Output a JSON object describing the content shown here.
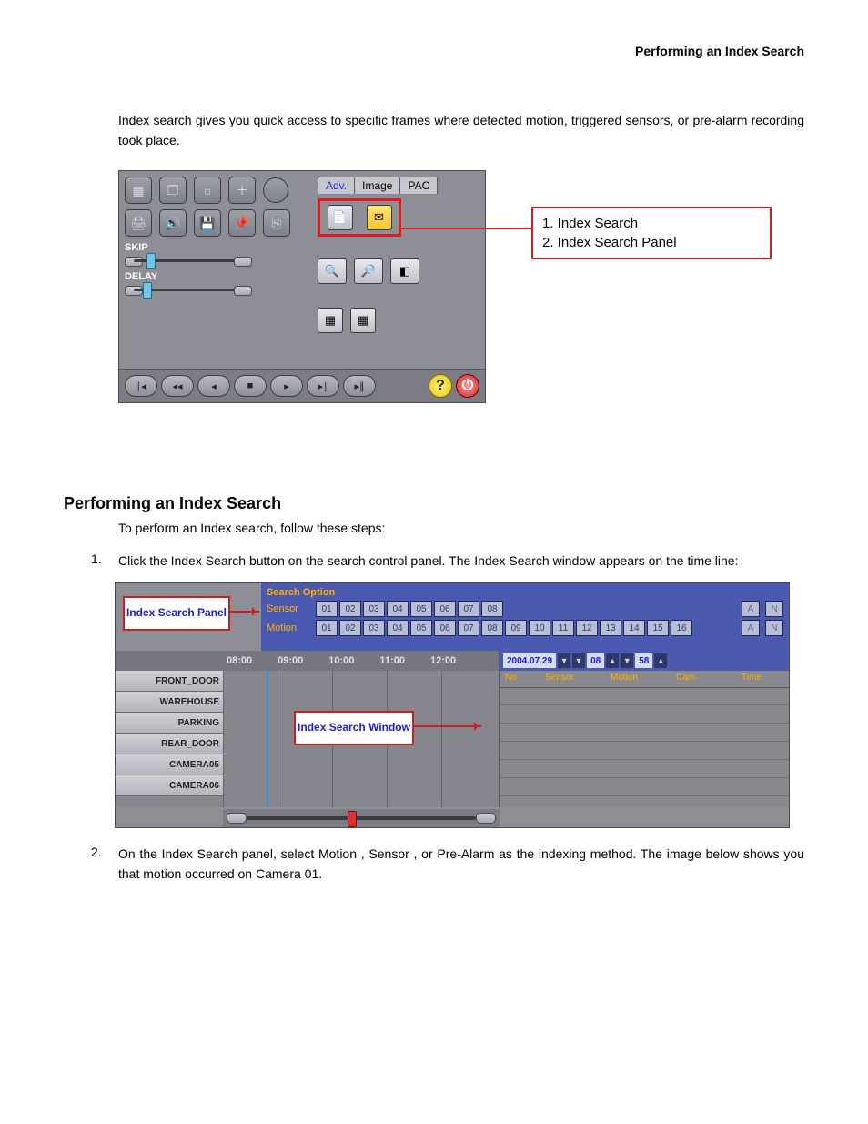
{
  "header": {
    "title": "Performing an Index Search"
  },
  "intro": "Index search gives you quick access to specific frames where detected motion, triggered sensors, or pre-alarm recording took place.",
  "fig1": {
    "tabs": [
      "Adv.",
      "Image",
      "PAC"
    ],
    "skip_label": "SKIP",
    "delay_label": "DELAY",
    "callout_lines": [
      "1. Index Search",
      "2. Index Search Panel"
    ]
  },
  "section_heading": "Performing an Index Search",
  "section_intro": "To perform an Index search, follow these steps:",
  "steps": [
    "Click the Index Search button on the search control panel. The Index Search window appears on the time line:",
    "On the Index Search panel, select Motion , Sensor , or Pre-Alarm as the indexing method. The image below shows you that motion occurred on Camera 01."
  ],
  "fig2": {
    "callouts": {
      "panel": "Index Search Panel",
      "window": "Index Search Window"
    },
    "search_option": {
      "title": "Search Option",
      "sensor_label": "Sensor",
      "motion_label": "Motion",
      "sensor_nums": [
        "01",
        "02",
        "03",
        "04",
        "05",
        "06",
        "07",
        "08"
      ],
      "motion_nums": [
        "01",
        "02",
        "03",
        "04",
        "05",
        "06",
        "07",
        "08",
        "09",
        "10",
        "11",
        "12",
        "13",
        "14",
        "15",
        "16"
      ],
      "an": [
        "A",
        "N"
      ]
    },
    "timeline_hours": [
      "08:00",
      "09:00",
      "10:00",
      "11:00",
      "12:00"
    ],
    "cameras": [
      "FRONT_DOOR",
      "WAREHOUSE",
      "PARKING",
      "REAR_DOOR",
      "CAMERA05",
      "CAMERA06"
    ],
    "index_window": {
      "date": "2004.07.29",
      "hour": "08",
      "minute": "58",
      "columns": [
        "No",
        "Sensor",
        "Motion",
        "Cam",
        "Time"
      ]
    }
  }
}
